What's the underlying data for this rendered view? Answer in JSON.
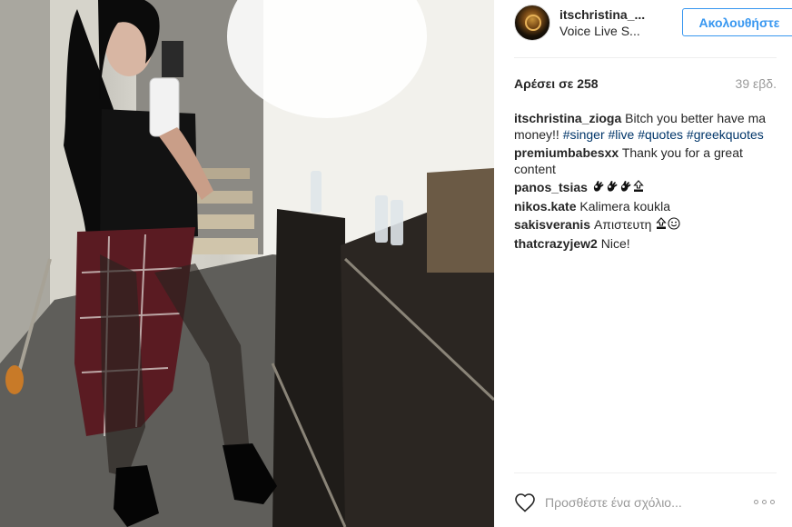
{
  "post": {
    "username": "itschristina_...",
    "location": "Voice Live S...",
    "follow_label": "Ακολουθήστε",
    "likes": "Αρέσει σε 258",
    "time_ago": "39 εβδ."
  },
  "comments": [
    {
      "user": "itschristina_zioga",
      "text": "Bitch you better have ma money!!",
      "tags": [
        "#singer",
        "#live",
        "#quotes",
        "#greekquotes"
      ]
    },
    {
      "user": "premiumbabesxx",
      "text": "Thank you for a great content"
    },
    {
      "user": "panos_tsias",
      "text": "",
      "emoji": [
        "ok-hand-icon",
        "ok-hand-icon",
        "ok-hand-icon",
        "top-arrow-icon"
      ]
    },
    {
      "user": "nikos.kate",
      "text": "Kalimera koukla"
    },
    {
      "user": "sakisveranis",
      "text": "Απιστευτη",
      "emoji": [
        "top-arrow-icon",
        "smiling-face-icon"
      ]
    },
    {
      "user": "thatcrazyjew2",
      "text": "Nice!"
    }
  ],
  "add_comment": {
    "placeholder": "Προσθέστε ένα σχόλιο..."
  },
  "icons": {
    "heart": "heart-outline-icon",
    "more": "more-options-icon"
  },
  "colors": {
    "follow_blue": "#3897f0",
    "hashtag": "#003569",
    "muted": "#999999",
    "text": "#262626"
  }
}
